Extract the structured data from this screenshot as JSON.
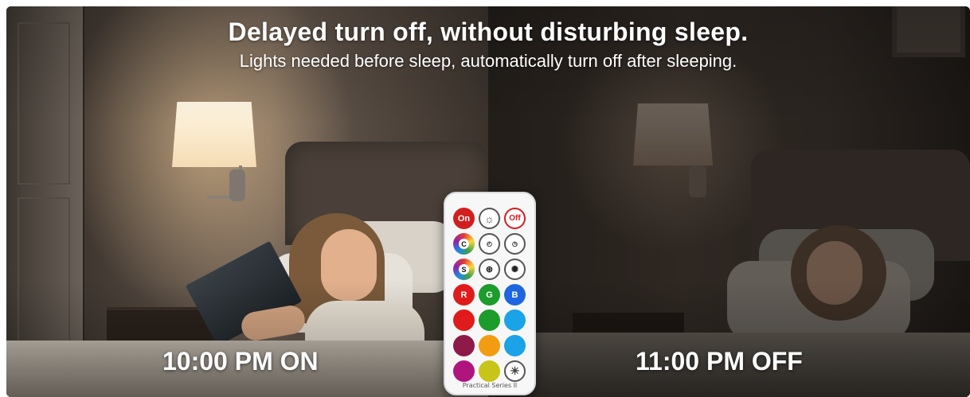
{
  "headline": "Delayed turn off, without disturbing sleep.",
  "subheadline": "Lights needed before sleep, automatically turn off after sleeping.",
  "left_time": "10:00 PM ON",
  "right_time": "11:00 PM OFF",
  "remote": {
    "buttons": {
      "on": "On",
      "off": "Off",
      "color_cycle": "C",
      "color_strobe": "S",
      "red": "R",
      "green": "G",
      "blue": "B"
    },
    "label": "Practical Series II",
    "colors": {
      "red": "#e01b1b",
      "green": "#1c9c2b",
      "blue": "#1e88e5",
      "orange": "#f39c12",
      "yellow": "#c9c41a",
      "magenta": "#b0157e",
      "maroon": "#8e1a4a",
      "sky": "#1aa3e6"
    }
  }
}
